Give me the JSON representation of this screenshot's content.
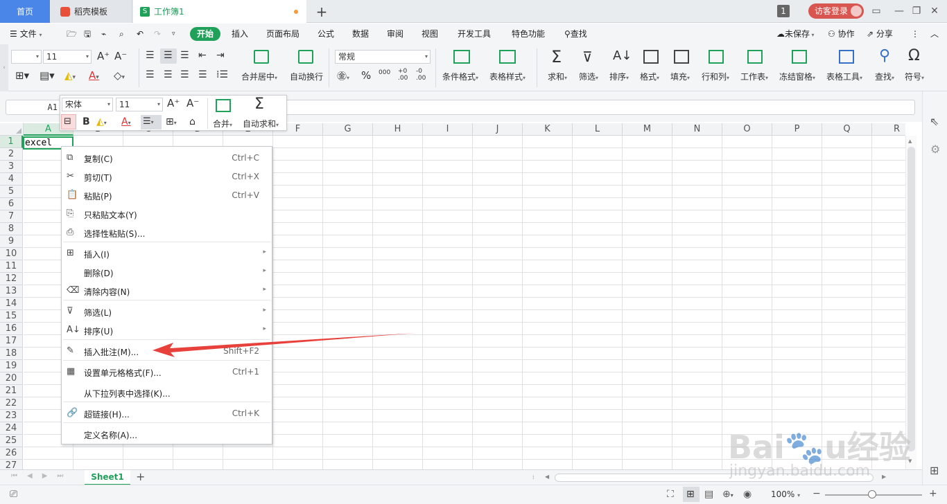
{
  "tabs": {
    "home": "首页",
    "template": "稻壳模板",
    "workbook": "工作簿1",
    "window_count": "1",
    "login": "访客登录"
  },
  "menu": {
    "file": "文件",
    "start": "开始",
    "items": [
      "插入",
      "页面布局",
      "公式",
      "数据",
      "审阅",
      "视图",
      "开发工具",
      "特色功能"
    ],
    "search": "查找",
    "unsaved": "未保存",
    "collab": "协作",
    "share": "分享"
  },
  "ribbon": {
    "font_size": "11",
    "merge_center": "合并居中",
    "wrap": "自动换行",
    "number_format": "常规",
    "cond_format": "条件格式",
    "table_style": "表格样式",
    "sum": "求和",
    "filter": "筛选",
    "sort": "排序",
    "format": "格式",
    "fill": "填充",
    "row_col": "行和列",
    "worksheet": "工作表",
    "freeze": "冻结窗格",
    "table_tools": "表格工具",
    "find": "查找",
    "symbol": "符号"
  },
  "formula": {
    "cell_ref": "A1"
  },
  "mini_toolbar": {
    "font": "宋体",
    "size": "11",
    "merge": "合并",
    "autosum": "自动求和"
  },
  "grid": {
    "columns": [
      "A",
      "B",
      "C",
      "D",
      "E",
      "F",
      "G",
      "H",
      "I",
      "J",
      "K",
      "L",
      "M",
      "N",
      "O",
      "P",
      "Q",
      "R"
    ],
    "rows": [
      "1",
      "2",
      "3",
      "4",
      "5",
      "6",
      "7",
      "8",
      "9",
      "10",
      "11",
      "12",
      "13",
      "14",
      "15",
      "16",
      "17",
      "18",
      "19",
      "20",
      "21",
      "22",
      "23",
      "24",
      "25",
      "26",
      "27"
    ],
    "a1_value": "excel"
  },
  "context_menu": [
    {
      "label": "复制(C)",
      "shortcut": "Ctrl+C",
      "icon": "copy-icon"
    },
    {
      "label": "剪切(T)",
      "shortcut": "Ctrl+X",
      "icon": "cut-icon"
    },
    {
      "label": "粘贴(P)",
      "shortcut": "Ctrl+V",
      "icon": "paste-icon"
    },
    {
      "label": "只粘贴文本(Y)",
      "shortcut": "",
      "icon": "paste-text-icon"
    },
    {
      "label": "选择性粘贴(S)...",
      "shortcut": "",
      "icon": "paste-special-icon"
    },
    {
      "label": "插入(I)",
      "shortcut": "",
      "icon": "insert-icon",
      "submenu": true
    },
    {
      "label": "删除(D)",
      "shortcut": "",
      "icon": "",
      "submenu": true
    },
    {
      "label": "清除内容(N)",
      "shortcut": "",
      "icon": "clear-icon",
      "submenu": true
    },
    {
      "label": "筛选(L)",
      "shortcut": "",
      "icon": "filter-icon",
      "submenu": true
    },
    {
      "label": "排序(U)",
      "shortcut": "",
      "icon": "sort-icon",
      "submenu": true
    },
    {
      "label": "插入批注(M)...",
      "shortcut": "Shift+F2",
      "icon": "comment-icon"
    },
    {
      "label": "设置单元格格式(F)...",
      "shortcut": "Ctrl+1",
      "icon": "format-cells-icon"
    },
    {
      "label": "从下拉列表中选择(K)...",
      "shortcut": "",
      "icon": ""
    },
    {
      "label": "超链接(H)...",
      "shortcut": "Ctrl+K",
      "icon": "link-icon"
    },
    {
      "label": "定义名称(A)...",
      "shortcut": "",
      "icon": ""
    }
  ],
  "sheets": {
    "active": "Sheet1"
  },
  "status": {
    "zoom": "100%"
  },
  "watermark": {
    "brand": "Baidu经验",
    "url": "jingyan.baidu.com"
  },
  "colors": {
    "accent_green": "#1fa15a",
    "tab_blue": "#4a86e8",
    "login_red": "#d95550",
    "arrow_red": "#e8413c"
  }
}
